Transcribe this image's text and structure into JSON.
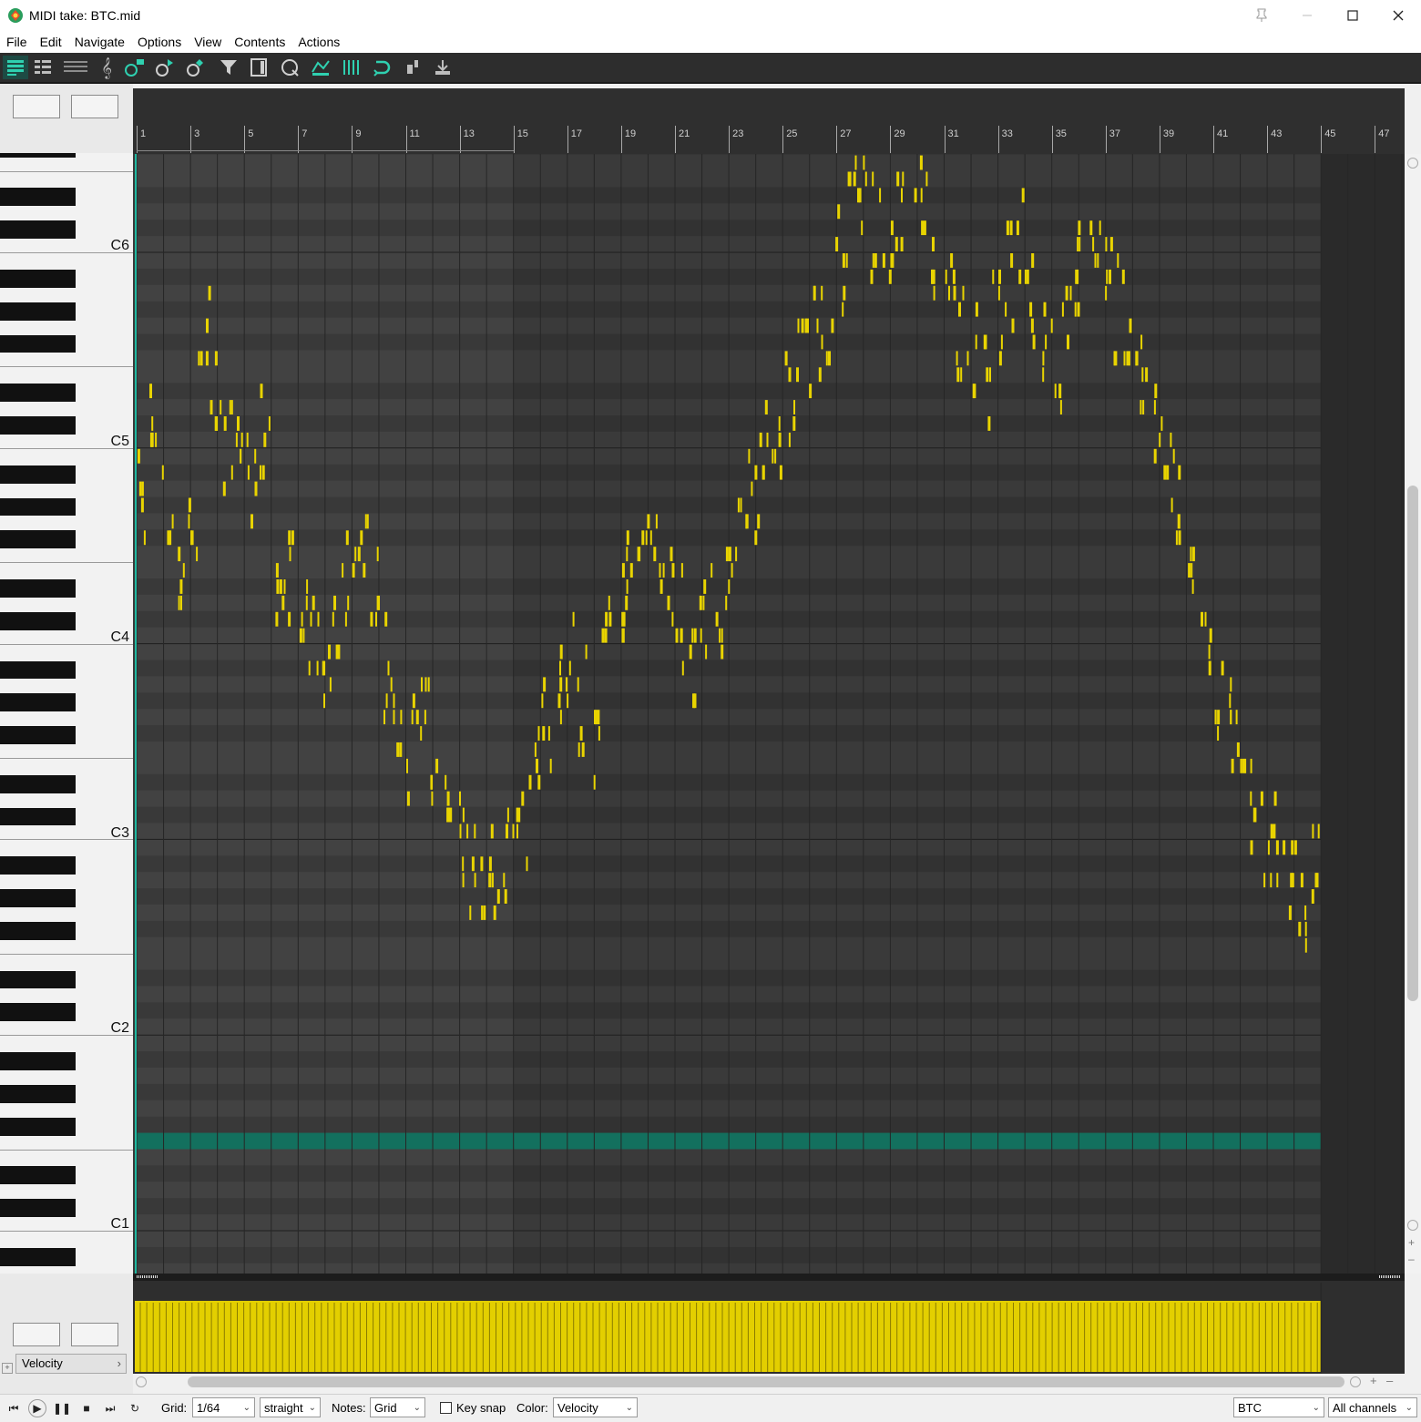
{
  "window": {
    "title": "MIDI take: BTC.mid",
    "controls": [
      "pin",
      "minimize",
      "maximize",
      "close"
    ]
  },
  "menu": [
    "File",
    "Edit",
    "Navigate",
    "Options",
    "View",
    "Contents",
    "Actions"
  ],
  "toolbar": {
    "icons": [
      "piano-roll-view-icon",
      "named-notes-view-icon",
      "event-list-view-icon",
      "notation-view-icon",
      "insert-note-icon",
      "play-note-icon",
      "edit-note-icon",
      "filter-icon",
      "media-item-lane-icon",
      "quantize-icon",
      "cc-lane-icon",
      "grid-icon",
      "loop-icon",
      "step-input-icon",
      "insert-icon"
    ]
  },
  "ruler": {
    "bar_labels": [
      "1",
      "3",
      "5",
      "7",
      "9",
      "11",
      "13",
      "15",
      "17",
      "19",
      "21",
      "23",
      "25",
      "27",
      "29",
      "31",
      "33",
      "35",
      "37",
      "39",
      "41",
      "43",
      "45",
      "47"
    ]
  },
  "piano": {
    "octave_labels": [
      "C6",
      "C5",
      "C4",
      "C3",
      "C2",
      "C1"
    ]
  },
  "editor": {
    "loop_start_bar": 1,
    "loop_end_bar": 15,
    "highlight_row_color": "#13705e",
    "note_color": "#e9d400",
    "last_bar": 45
  },
  "velocity_lane": {
    "label": "Velocity",
    "color": "#e3cf00"
  },
  "bottom": {
    "grid_label": "Grid:",
    "grid_value": "1/64",
    "swing_value": "straight",
    "notes_label": "Notes:",
    "notes_value": "Grid",
    "keysnap_label": "Key snap",
    "keysnap_checked": false,
    "color_label": "Color:",
    "color_value": "Velocity",
    "take_value": "BTC",
    "channel_value": "All channels"
  }
}
